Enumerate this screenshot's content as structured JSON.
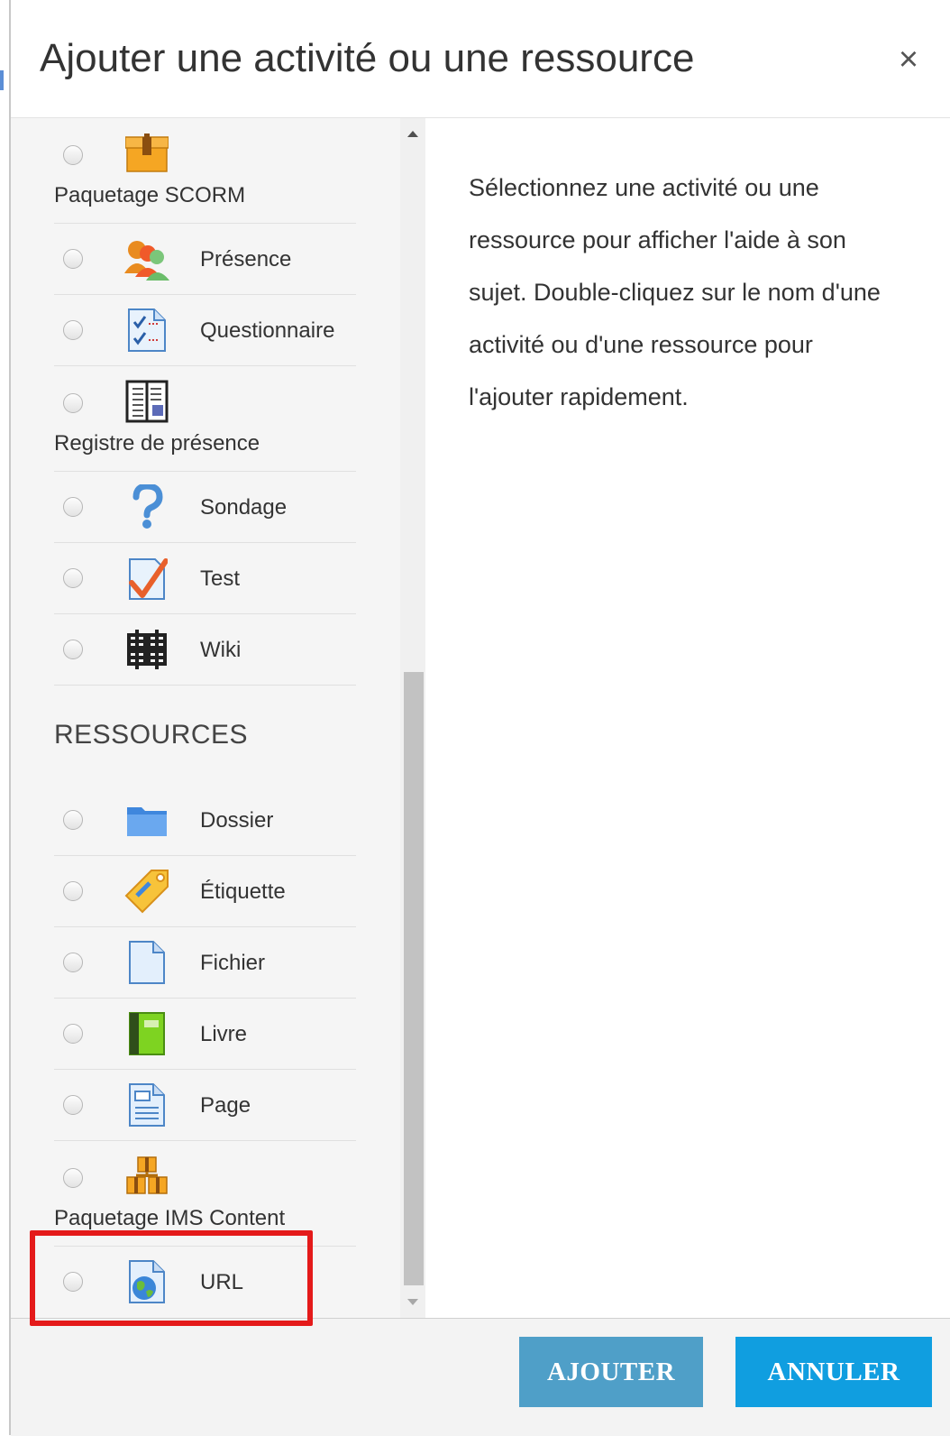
{
  "dialog": {
    "title": "Ajouter une activité ou une ressource",
    "close_glyph": "×"
  },
  "activities": [
    {
      "label": "Paquetage SCORM",
      "icon": "scorm-package-icon",
      "layout": "below"
    },
    {
      "label": "Présence",
      "icon": "attendance-people-icon",
      "layout": "side"
    },
    {
      "label": "Questionnaire",
      "icon": "questionnaire-icon",
      "layout": "side"
    },
    {
      "label": "Registre de présence",
      "icon": "attendance-register-icon",
      "layout": "below"
    },
    {
      "label": "Sondage",
      "icon": "survey-question-icon",
      "layout": "side"
    },
    {
      "label": "Test",
      "icon": "quiz-check-icon",
      "layout": "side"
    },
    {
      "label": "Wiki",
      "icon": "wiki-icon",
      "layout": "side"
    }
  ],
  "resources_section": {
    "title": "RESSOURCES"
  },
  "resources": [
    {
      "label": "Dossier",
      "icon": "folder-icon",
      "layout": "side"
    },
    {
      "label": "Étiquette",
      "icon": "label-tag-icon",
      "layout": "side"
    },
    {
      "label": "Fichier",
      "icon": "file-icon",
      "layout": "side"
    },
    {
      "label": "Livre",
      "icon": "book-icon",
      "layout": "side"
    },
    {
      "label": "Page",
      "icon": "page-icon",
      "layout": "side"
    },
    {
      "label": "Paquetage IMS Content",
      "icon": "ims-content-icon",
      "layout": "below"
    },
    {
      "label": "URL",
      "icon": "url-globe-icon",
      "layout": "side"
    }
  ],
  "help_text": "Sélectionnez une activité ou une ressource pour afficher l'aide à son sujet. Double-cliquez sur le nom d'une activité ou d'une ressource pour l'ajouter rapidement.",
  "buttons": {
    "add": "AJOUTER",
    "cancel": "ANNULER"
  },
  "colors": {
    "highlight": "#e41a1a",
    "add_button": "#4f9fc8",
    "cancel_button": "#109ee0"
  }
}
